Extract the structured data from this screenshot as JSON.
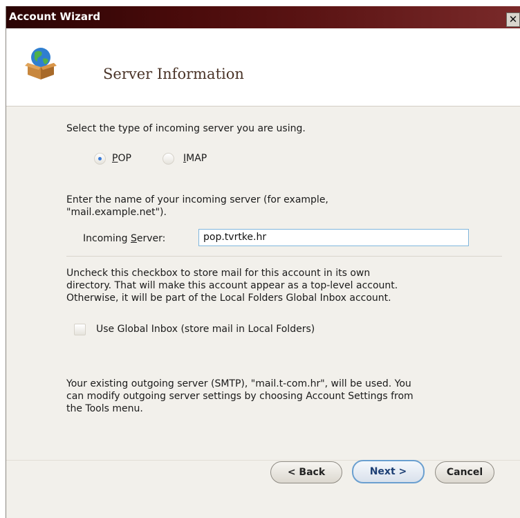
{
  "window": {
    "title": "Account Wizard",
    "close_symbol": "✕"
  },
  "header": {
    "title": "Server Information",
    "icon": "globe-box-icon"
  },
  "server_type": {
    "prompt": "Select the type of incoming server you are using.",
    "options": [
      {
        "label_key": "P",
        "label_rest": "OP",
        "selected": true
      },
      {
        "label_key": "I",
        "label_rest": "MAP",
        "selected": false
      }
    ]
  },
  "incoming": {
    "prompt_line1": "Enter the name of your incoming server (for example,",
    "prompt_line2": "\"mail.example.net\").",
    "label_pre": "Incoming ",
    "label_key": "S",
    "label_rest": "erver:",
    "value": "pop.tvrtke.hr"
  },
  "global_inbox": {
    "text_line1": "Uncheck this checkbox to store mail for this account in its own",
    "text_line2": "directory. That will make this account appear as a top-level account.",
    "text_line3": "Otherwise, it will be part of the Local Folders Global Inbox account.",
    "checkbox_label": "Use Global Inbox (store mail in Local Folders)",
    "checked": false
  },
  "outgoing": {
    "line1": "Your existing outgoing server (SMTP), \"mail.t-com.hr\", will be used. You",
    "line2": "can modify outgoing server settings by choosing Account Settings from",
    "line3": "the Tools menu."
  },
  "buttons": {
    "back": "< Back",
    "next": "Next >",
    "cancel": "Cancel"
  },
  "colors": {
    "titlebar": "#4a0b0b",
    "accent": "#3a7ad6",
    "background": "#f2f0eb"
  }
}
